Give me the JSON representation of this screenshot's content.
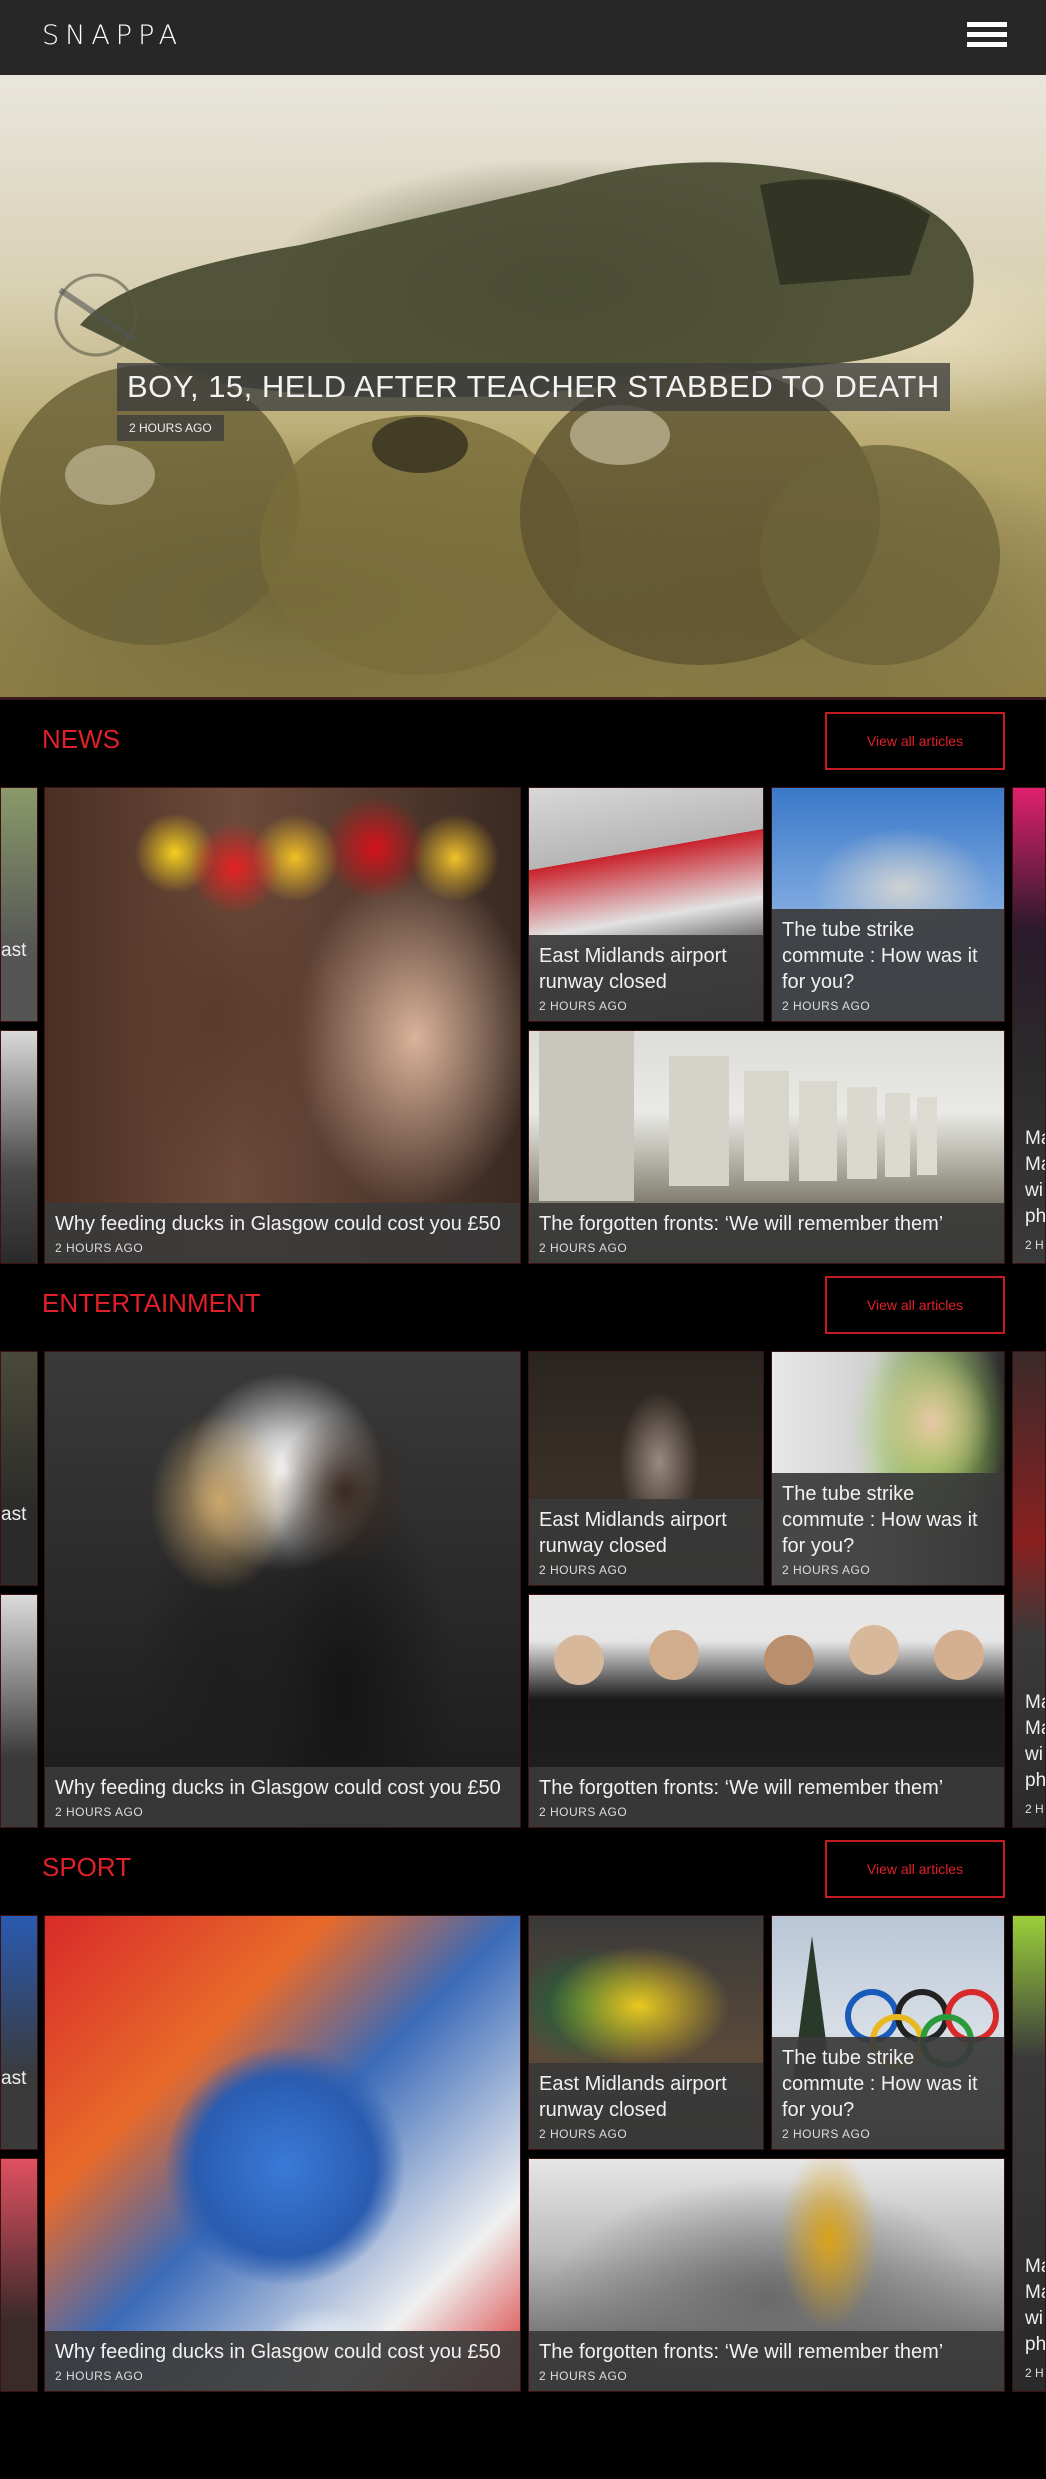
{
  "header": {
    "logo": "SNAPPA"
  },
  "hero": {
    "title": "BOY, 15, HELD AFTER TEACHER STABBED TO DEATH",
    "time": "2 HOURS AGO"
  },
  "sections": [
    {
      "title": "NEWS",
      "view_all": "View all articles",
      "large": {
        "title": "Why feeding ducks in Glasgow could cost you £50",
        "time": "2 HOURS AGO"
      },
      "small1": {
        "title": "East Midlands airport runway closed",
        "time": "2 HOURS AGO"
      },
      "small2": {
        "title": "The tube strike commute : How was it for you?",
        "time": "2 HOURS AGO"
      },
      "wide": {
        "title": "The forgotten fronts: ‘We will remember them’",
        "time": "2 HOURS AGO"
      },
      "left_edge": "ast",
      "right_edge": [
        "Ma",
        "Ma",
        "wi",
        "ph",
        "2 H"
      ]
    },
    {
      "title": "ENTERTAINMENT",
      "view_all": "View all articles",
      "large": {
        "title": "Why feeding ducks in Glasgow could cost you £50",
        "time": "2 HOURS AGO"
      },
      "small1": {
        "title": "East Midlands airport runway closed",
        "time": "2 HOURS AGO"
      },
      "small2": {
        "title": "The tube strike commute : How was it for you?",
        "time": "2 HOURS AGO"
      },
      "wide": {
        "title": "The forgotten fronts: ‘We will remember them’",
        "time": "2 HOURS AGO"
      },
      "left_edge": "ast",
      "right_edge": [
        "Ma",
        "Ma",
        "wi",
        "ph",
        "2 H"
      ]
    },
    {
      "title": "SPORT",
      "view_all": "View all articles",
      "large": {
        "title": "Why feeding ducks in Glasgow could cost you £50",
        "time": "2 HOURS AGO"
      },
      "small1": {
        "title": "East Midlands airport runway closed",
        "time": "2 HOURS AGO"
      },
      "small2": {
        "title": "The tube strike commute : How was it for you?",
        "time": "2 HOURS AGO"
      },
      "wide": {
        "title": "The forgotten fronts: ‘We will remember them’",
        "time": "2 HOURS AGO"
      },
      "left_edge": "ast",
      "right_edge": [
        "Ma",
        "Ma",
        "wi",
        "ph",
        "2 H"
      ]
    }
  ]
}
